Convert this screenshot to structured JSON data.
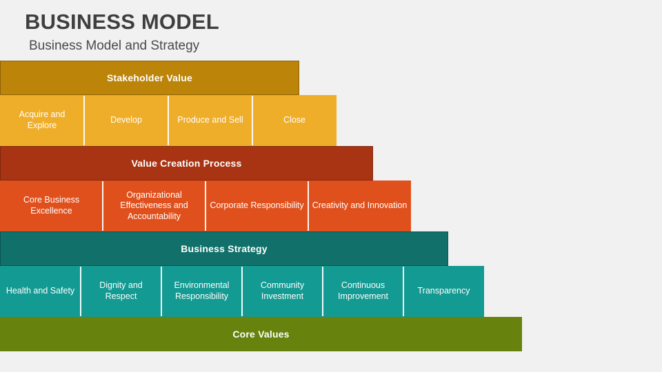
{
  "header": {
    "title": "BUSINESS MODEL",
    "subtitle": "Business Model and Strategy"
  },
  "colors": {
    "background": "#f1f1f1",
    "title_text": "#3f3f3f",
    "tier1_band": "#bc8408",
    "tier1_cells": "#efae2a",
    "tier2_band": "#a83414",
    "tier2_cells": "#e0501c",
    "tier3_band": "#11706a",
    "tier3_cells": "#139a92",
    "tier4_band": "#67820d",
    "cell_text": "#ffffff"
  },
  "pyramid": {
    "tiers": [
      {
        "band_label": "Stakeholder Value",
        "items": [
          {
            "label": "Acquire and Explore"
          },
          {
            "label": "Develop"
          },
          {
            "label": "Produce and Sell"
          },
          {
            "label": "Close"
          }
        ]
      },
      {
        "band_label": "Value Creation Process",
        "items": [
          {
            "label": "Core Business Excellence"
          },
          {
            "label": "Organizational Effectiveness and Accountability"
          },
          {
            "label": "Corporate Responsibility"
          },
          {
            "label": "Creativity and Innovation"
          }
        ]
      },
      {
        "band_label": "Business Strategy",
        "items": [
          {
            "label": "Health and Safety"
          },
          {
            "label": "Dignity and Respect"
          },
          {
            "label": "Environmental Responsibility"
          },
          {
            "label": "Community Investment"
          },
          {
            "label": "Continuous Improvement"
          },
          {
            "label": "Transparency"
          }
        ]
      },
      {
        "band_label": "Core Values",
        "items": []
      }
    ]
  }
}
